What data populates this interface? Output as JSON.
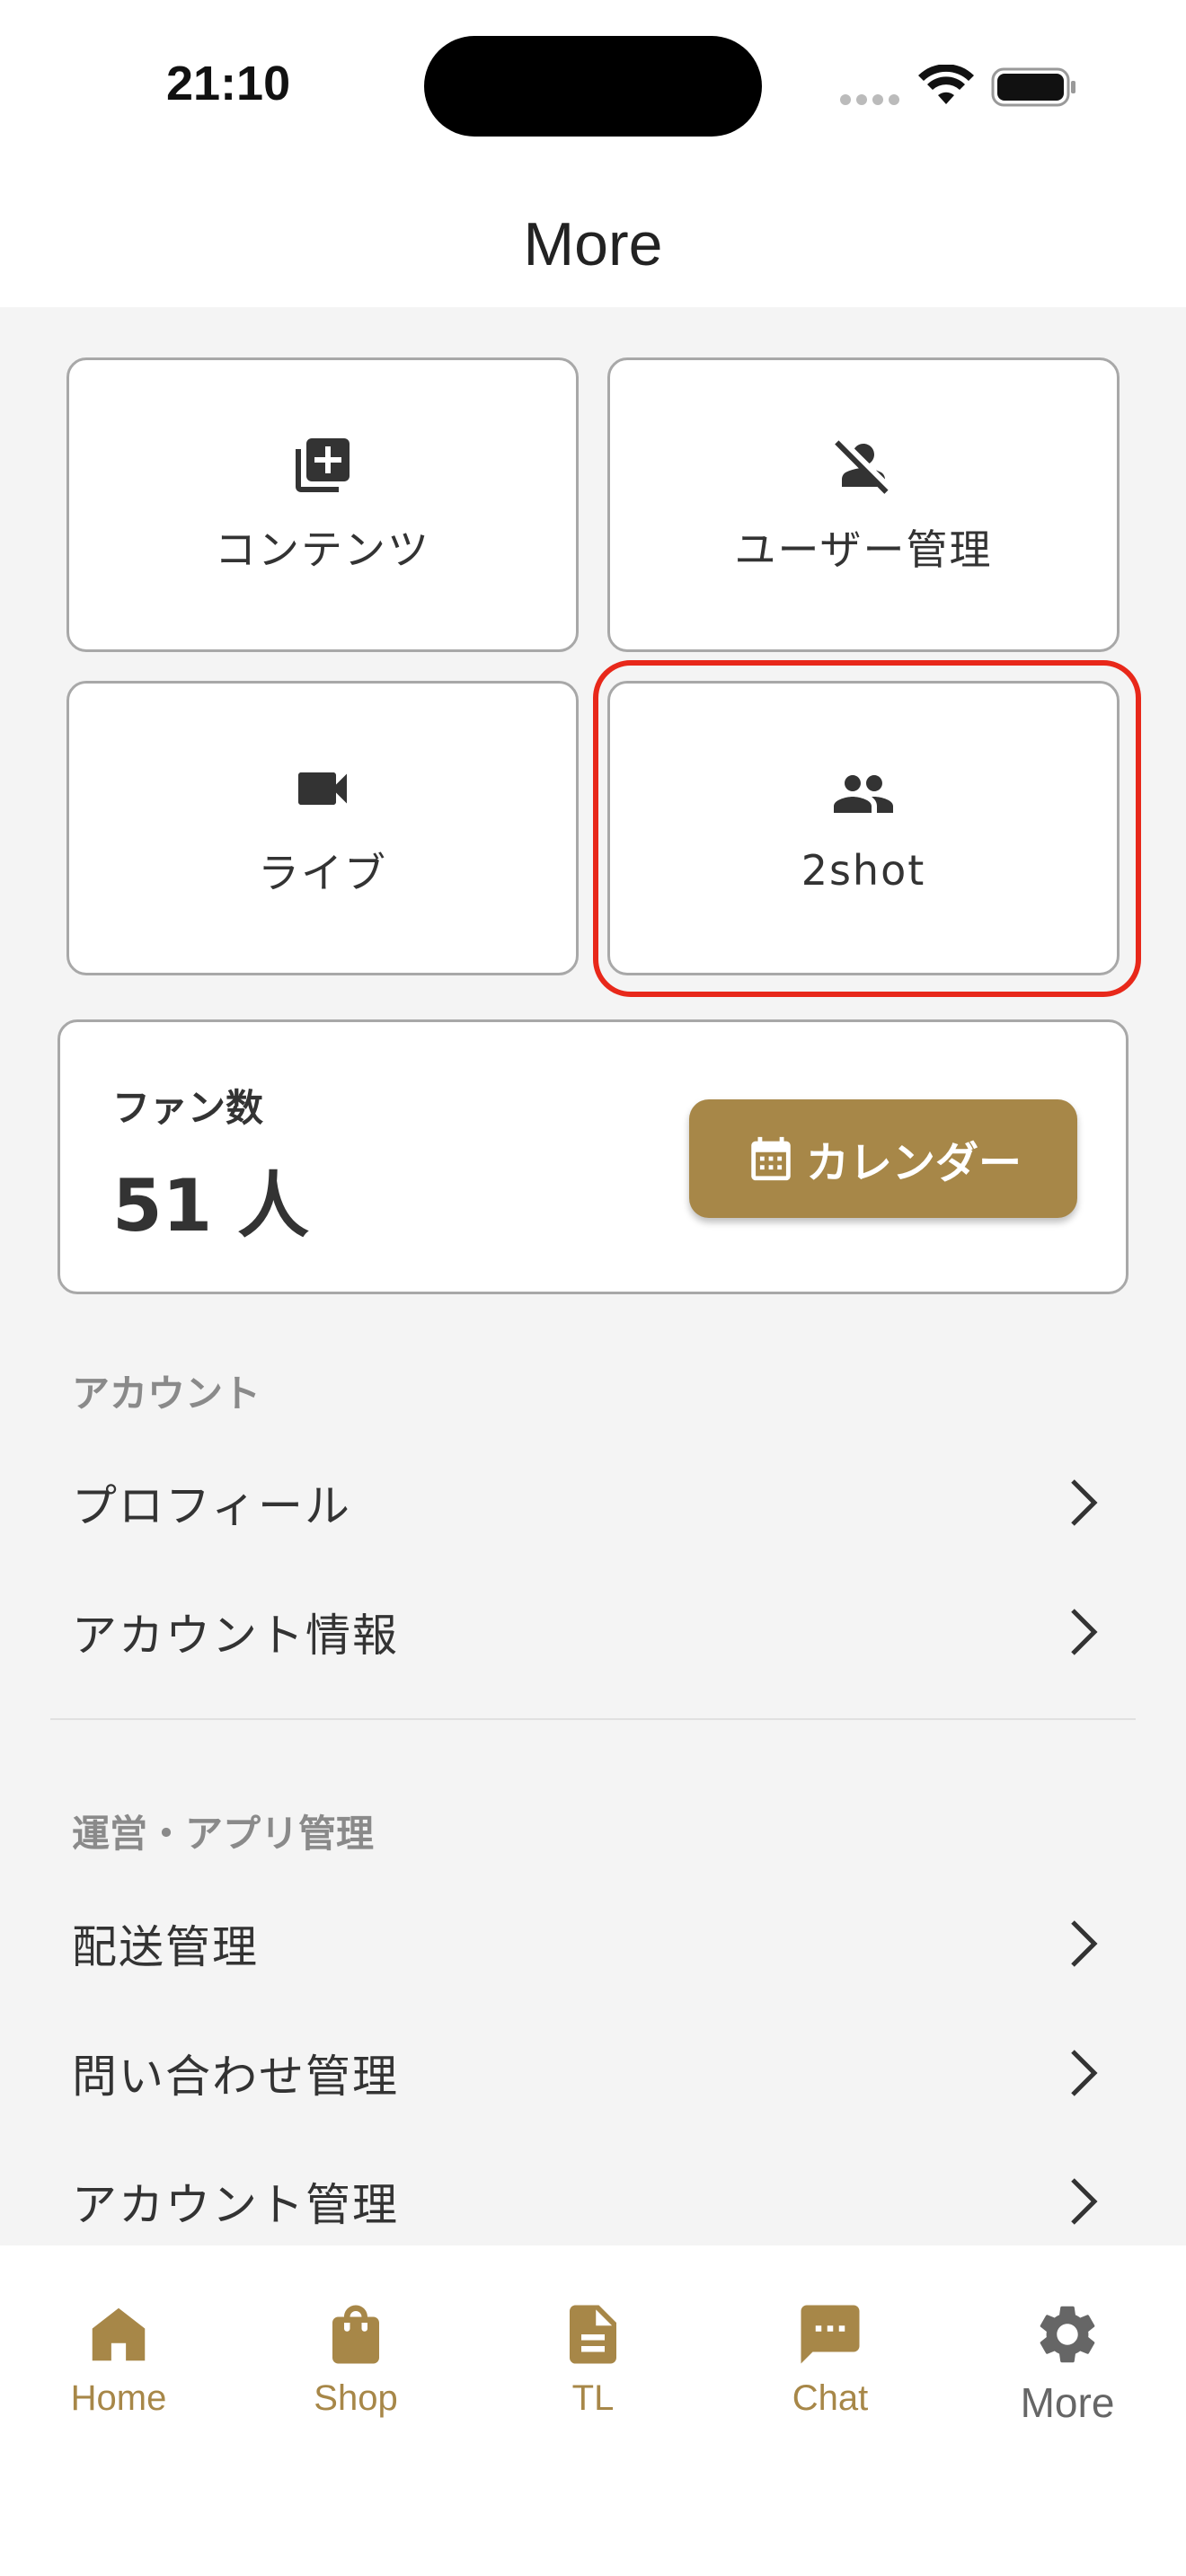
{
  "status_bar": {
    "time": "21:10"
  },
  "header": {
    "title": "More"
  },
  "tiles": [
    {
      "label": "コンテンツ",
      "icon": "library-add-icon"
    },
    {
      "label": "ユーザー管理",
      "icon": "person-off-icon"
    },
    {
      "label": "ライブ",
      "icon": "videocam-icon"
    },
    {
      "label": "2shot",
      "icon": "people-icon"
    }
  ],
  "fan_card": {
    "label": "ファン数",
    "count": "51 人",
    "calendar_button": "カレンダー"
  },
  "sections": [
    {
      "header": "アカウント",
      "items": [
        "プロフィール",
        "アカウント情報"
      ]
    },
    {
      "header": "運営・アプリ管理",
      "items": [
        "配送管理",
        "問い合わせ管理",
        "アカウント管理"
      ]
    }
  ],
  "bottom_nav": [
    {
      "label": "Home",
      "icon": "home-icon"
    },
    {
      "label": "Shop",
      "icon": "shopping-bag-icon"
    },
    {
      "label": "TL",
      "icon": "article-icon"
    },
    {
      "label": "Chat",
      "icon": "chat-icon"
    },
    {
      "label": "More",
      "icon": "gear-icon",
      "active": true
    }
  ],
  "colors": {
    "accent": "#a78748",
    "highlight": "#e8281a",
    "background": "#f4f4f4"
  }
}
